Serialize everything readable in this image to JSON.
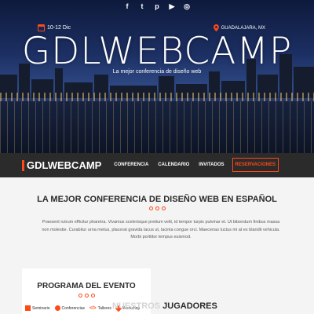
{
  "social": {
    "icons": [
      "facebook-icon",
      "twitter-icon",
      "pinterest-icon",
      "youtube-icon",
      "instagram-icon"
    ]
  },
  "hero": {
    "date": "10-12 Dic",
    "location": "GUADALAJARA, MX",
    "title": "GDLWEBCAMP",
    "subtitle": "La mejor conferencia de diseño web"
  },
  "header": {
    "logo": "GDLWEBCAMP",
    "nav": [
      {
        "label": "CONFERENCIA"
      },
      {
        "label": "CALENDARIO"
      },
      {
        "label": "INVITADOS"
      },
      {
        "label": "RESERVACIONES"
      }
    ]
  },
  "intro": {
    "title": "LA MEJOR CONFERENCIA DE DISEÑO WEB EN ESPAÑOL",
    "text": "Praesent rutrum efficitur pharetra. Vivamus scelerisque pretium velit, id tempor turpis pulvinar et. Ut bibendum finibus massa non molestie. Curabitur urna metus, placerat gravida lacus ut, lacinia congue orci. Maecenas luctus mi at ex blandit vehicula. Morbi porttitor tempus euismod."
  },
  "program": {
    "title": "PROGRAMA DEL EVENTO",
    "tabs": [
      {
        "label": "Seminario",
        "icon": "university-icon"
      },
      {
        "label": "Conferencias",
        "icon": "comment-icon"
      },
      {
        "label": "Talleres",
        "icon": "code-icon"
      },
      {
        "label": "Workshop",
        "icon": "tools-icon"
      }
    ]
  },
  "speakers": {
    "title_prefix": "NUESTROS",
    "title_rest": " JUGADORES"
  },
  "colors": {
    "accent": "#fe4918",
    "dark": "#2b2b2b",
    "background": "#f4f4f4"
  }
}
